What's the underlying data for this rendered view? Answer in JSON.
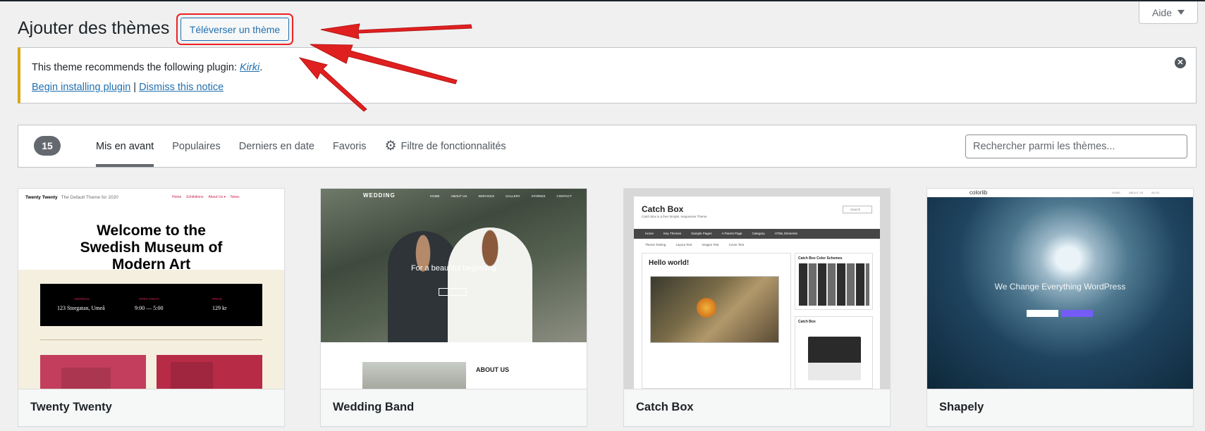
{
  "header": {
    "title": "Ajouter des thèmes",
    "upload_label": "Téléverser un thème",
    "help_label": "Aide"
  },
  "notice": {
    "text_before": "This theme recommends the following plugin: ",
    "plugin_name": "Kirki",
    "text_after": ".",
    "install_link": "Begin installing plugin",
    "separator": " | ",
    "dismiss_link": "Dismiss this notice"
  },
  "filters": {
    "count": "15",
    "tabs": [
      "Mis en avant",
      "Populaires",
      "Derniers en date",
      "Favoris",
      "Filtre de fonctionnalités"
    ],
    "search_placeholder": "Rechercher parmi les thèmes..."
  },
  "themes": [
    {
      "name": "Twenty Twenty",
      "preview": {
        "site_title": "Twenty Twenty",
        "site_tagline": "The Default Theme for 2020",
        "menu": [
          "Home",
          "Exhibitions",
          "About Us ▾",
          "News"
        ],
        "heading": "Welcome to the Swedish Museum of Modern Art",
        "info_labels": [
          "ADDRESS",
          "OPEN TODAY",
          "PRICE"
        ],
        "info_values": [
          "123 Storgatan, Umeå",
          "9:00 — 5:00",
          "129 kr"
        ]
      }
    },
    {
      "name": "Wedding Band",
      "preview": {
        "logo": "WEDDING",
        "menu": [
          "HOME",
          "ABOUT US",
          "SERVICES",
          "GALLERY",
          "STORIES",
          "CONTACT"
        ],
        "tagline": "For a beautiful beginning",
        "about": "ABOUT US"
      }
    },
    {
      "name": "Catch Box",
      "preview": {
        "site_title": "Catch Box",
        "site_tagline": "Catch Box is a free Simple, responsive Theme",
        "search": "Search",
        "menu": [
          "Home",
          "Key Themes",
          "Sample Pages",
          "A Parent Page",
          "Category",
          "HTML Elements"
        ],
        "menu2": [
          "Theme Testing",
          "Layout Test",
          "Images Test",
          "Cover Test"
        ],
        "post_title": "Hello world!",
        "widget1": "Catch Box Color Schemes",
        "widget2": "Catch Box"
      }
    },
    {
      "name": "Shapely",
      "preview": {
        "logo": "colorlib",
        "menu": [
          "HOME",
          "ABOUT US",
          "BLOG"
        ],
        "headline": "We Change Everything WordPress"
      }
    }
  ],
  "colors": {
    "link": "#2271b1",
    "notice_border": "#dba617",
    "annotation_red": "#e02020"
  }
}
